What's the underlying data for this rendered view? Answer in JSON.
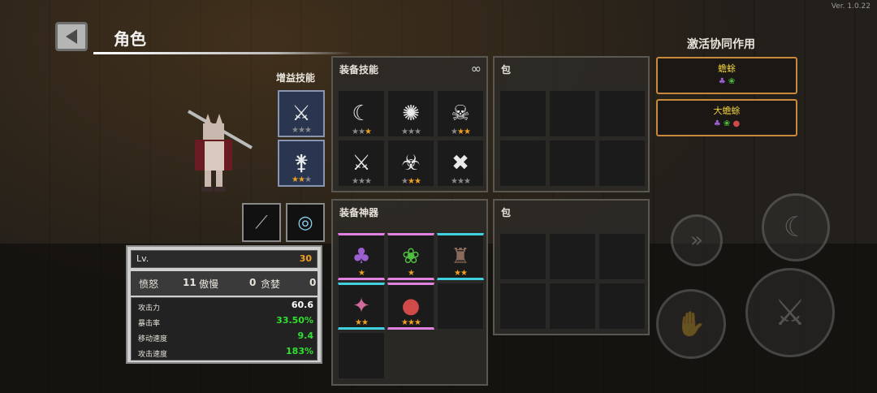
{
  "version": "Ver. 1.0.22",
  "header": {
    "title": "角色"
  },
  "buff_skills": {
    "label": "增益技能",
    "slots": [
      {
        "icon": "crossed-blades-icon",
        "stars": [
          false,
          false,
          false
        ]
      },
      {
        "icon": "arrows-sword-icon",
        "stars": [
          true,
          true,
          false
        ]
      }
    ]
  },
  "equip_skills": {
    "title": "装备技能",
    "link_icon": "chain-link-icon",
    "slots": [
      {
        "icon": "crescent-moon-icon",
        "glyph": "☾",
        "stars": [
          false,
          false,
          true
        ]
      },
      {
        "icon": "burst-icon",
        "glyph": "✺",
        "stars": [
          false,
          false,
          false
        ]
      },
      {
        "icon": "skull-icon",
        "glyph": "☠",
        "stars": [
          false,
          true,
          true
        ]
      },
      {
        "icon": "dagger-icon",
        "glyph": "⚔",
        "stars": [
          false,
          false,
          false
        ]
      },
      {
        "icon": "biohazard-icon",
        "glyph": "☣",
        "stars": [
          false,
          true,
          true
        ]
      },
      {
        "icon": "bone-icon",
        "glyph": "✖",
        "stars": [
          false,
          false,
          false
        ]
      }
    ]
  },
  "bag_top": {
    "title": "包"
  },
  "equip_artifacts": {
    "title": "装备神器",
    "slots": [
      {
        "icon": "purple-toad-icon",
        "glyph": "♣",
        "color": "#9b5fd0",
        "stars": [
          true
        ],
        "border": "pink"
      },
      {
        "icon": "green-blobs-icon",
        "glyph": "❀",
        "color": "#4fbf3f",
        "stars": [
          true
        ],
        "border": "pink"
      },
      {
        "icon": "key-doll-icon",
        "glyph": "♜",
        "color": "#8a6a5a",
        "stars": [
          true,
          true
        ],
        "border": "cyan"
      },
      {
        "icon": "crystal-icon",
        "glyph": "✦",
        "color": "#d06a9a",
        "stars": [
          true,
          true
        ],
        "border": "cyan"
      },
      {
        "icon": "red-egg-icon",
        "glyph": "●",
        "color": "#d04a4a",
        "stars": [
          true,
          true,
          true
        ],
        "border": "pink"
      }
    ]
  },
  "bag_bottom": {
    "title": "包"
  },
  "synergy": {
    "title": "激活协同作用",
    "items": [
      {
        "name": "蟾蜍",
        "dots": [
          "#9b5fd0",
          "#4fbf3f"
        ]
      },
      {
        "name": "大蟾蜍",
        "dots": [
          "#9b5fd0",
          "#4fbf3f",
          "#d04a4a"
        ]
      }
    ]
  },
  "stats": {
    "lv_label": "Lv.",
    "lv_value": "30",
    "sins": [
      {
        "label": "愤怒",
        "value": "11"
      },
      {
        "label": "傲慢",
        "value": "0"
      },
      {
        "label": "贪婪",
        "value": "0"
      }
    ],
    "attributes": [
      {
        "label": "攻击力",
        "value": "60.6",
        "color": "#ffffff"
      },
      {
        "label": "暴击率",
        "value": "33.50%",
        "color": "#30e030"
      },
      {
        "label": "移动速度",
        "value": "9.4",
        "color": "#30e030"
      },
      {
        "label": "攻击速度",
        "value": "183%",
        "color": "#30e030"
      }
    ]
  },
  "weapons": [
    {
      "icon": "spear-icon",
      "glyph": "⟋"
    },
    {
      "icon": "wind-orb-icon",
      "glyph": "◎"
    }
  ]
}
